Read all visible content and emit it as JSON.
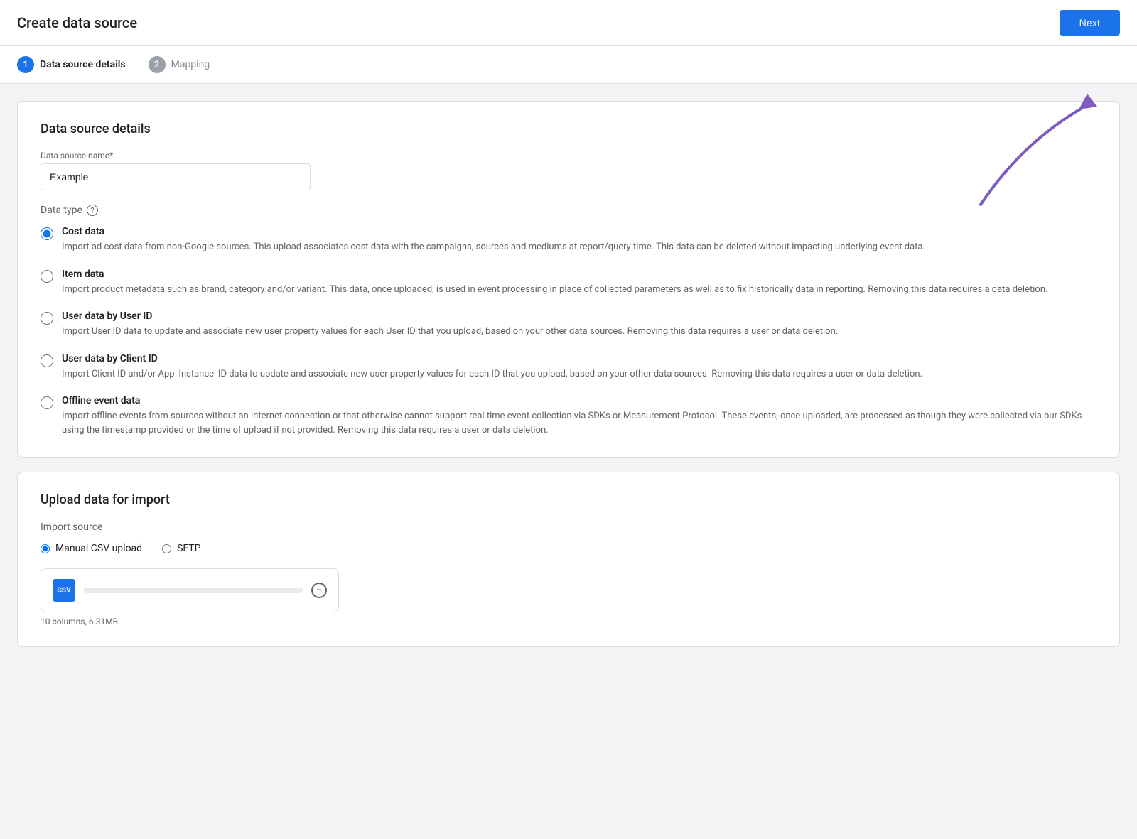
{
  "page": {
    "title": "Create data source"
  },
  "header": {
    "next_button_label": "Next"
  },
  "steps": [
    {
      "id": 1,
      "label": "Data source details",
      "state": "active"
    },
    {
      "id": 2,
      "label": "Mapping",
      "state": "inactive"
    }
  ],
  "data_source_section": {
    "title": "Data source details",
    "name_field": {
      "label": "Data source name*",
      "placeholder": "",
      "value": "Example"
    },
    "data_type_label": "Data type",
    "data_type_options": [
      {
        "id": "cost_data",
        "title": "Cost data",
        "description": "Import ad cost data from non-Google sources. This upload associates cost data with the campaigns, sources and mediums at report/query time. This data can be deleted without impacting underlying event data.",
        "selected": true
      },
      {
        "id": "item_data",
        "title": "Item data",
        "description": "Import product metadata such as brand, category and/or variant. This data, once uploaded, is used in event processing in place of collected parameters as well as to fix historically data in reporting. Removing this data requires a data deletion.",
        "selected": false
      },
      {
        "id": "user_data_user_id",
        "title": "User data by User ID",
        "description": "Import User ID data to update and associate new user property values for each User ID that you upload, based on your other data sources. Removing this data requires a user or data deletion.",
        "selected": false
      },
      {
        "id": "user_data_client_id",
        "title": "User data by Client ID",
        "description": "Import Client ID and/or App_Instance_ID data to update and associate new user property values for each ID that you upload, based on your other data sources. Removing this data requires a user or data deletion.",
        "selected": false
      },
      {
        "id": "offline_event_data",
        "title": "Offline event data",
        "description": "Import offline events from sources without an internet connection or that otherwise cannot support real time event collection via SDKs or Measurement Protocol. These events, once uploaded, are processed as though they were collected via our SDKs using the timestamp provided or the time of upload if not provided. Removing this data requires a user or data deletion.",
        "selected": false
      }
    ]
  },
  "upload_section": {
    "title": "Upload data for import",
    "import_source_label": "Import source",
    "import_options": [
      {
        "id": "manual_csv",
        "label": "Manual CSV upload",
        "selected": true
      },
      {
        "id": "sftp",
        "label": "SFTP",
        "selected": false
      }
    ],
    "file_meta": "10 columns, 6.31MB"
  },
  "arrow_annotation": {
    "color": "#7c5cbf"
  }
}
